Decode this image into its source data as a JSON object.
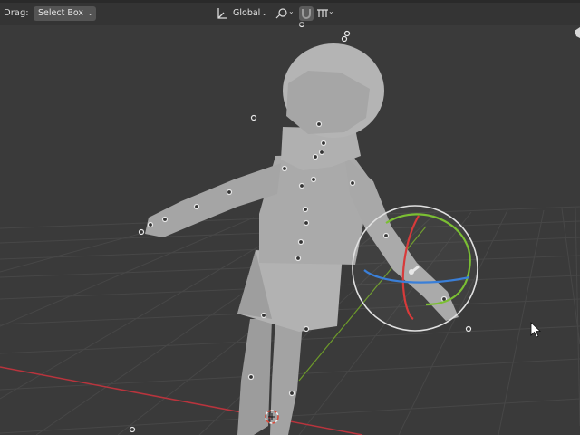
{
  "header": {
    "drag_label": "Drag:",
    "select_mode": "Select Box",
    "orientation": "Global",
    "orientation_icon": "transform-orientation-icon",
    "pivot_icon": "pivot-point-icon",
    "snap_icon": "snap-magnet-icon",
    "proportional_icon": "proportional-editing-icon"
  },
  "viewport": {
    "background": "#3a3a3a",
    "grid_color": "#474747",
    "x_axis_color": "#b8343d",
    "y_axis_color": "#6d9a2a",
    "model_color": "#a9a9a9"
  },
  "gizmo": {
    "x_ring_color": "#d83a3a",
    "y_ring_color": "#7bbf33",
    "z_ring_color": "#3a7fd8",
    "outer_ring_color": "#e0e0e0"
  }
}
